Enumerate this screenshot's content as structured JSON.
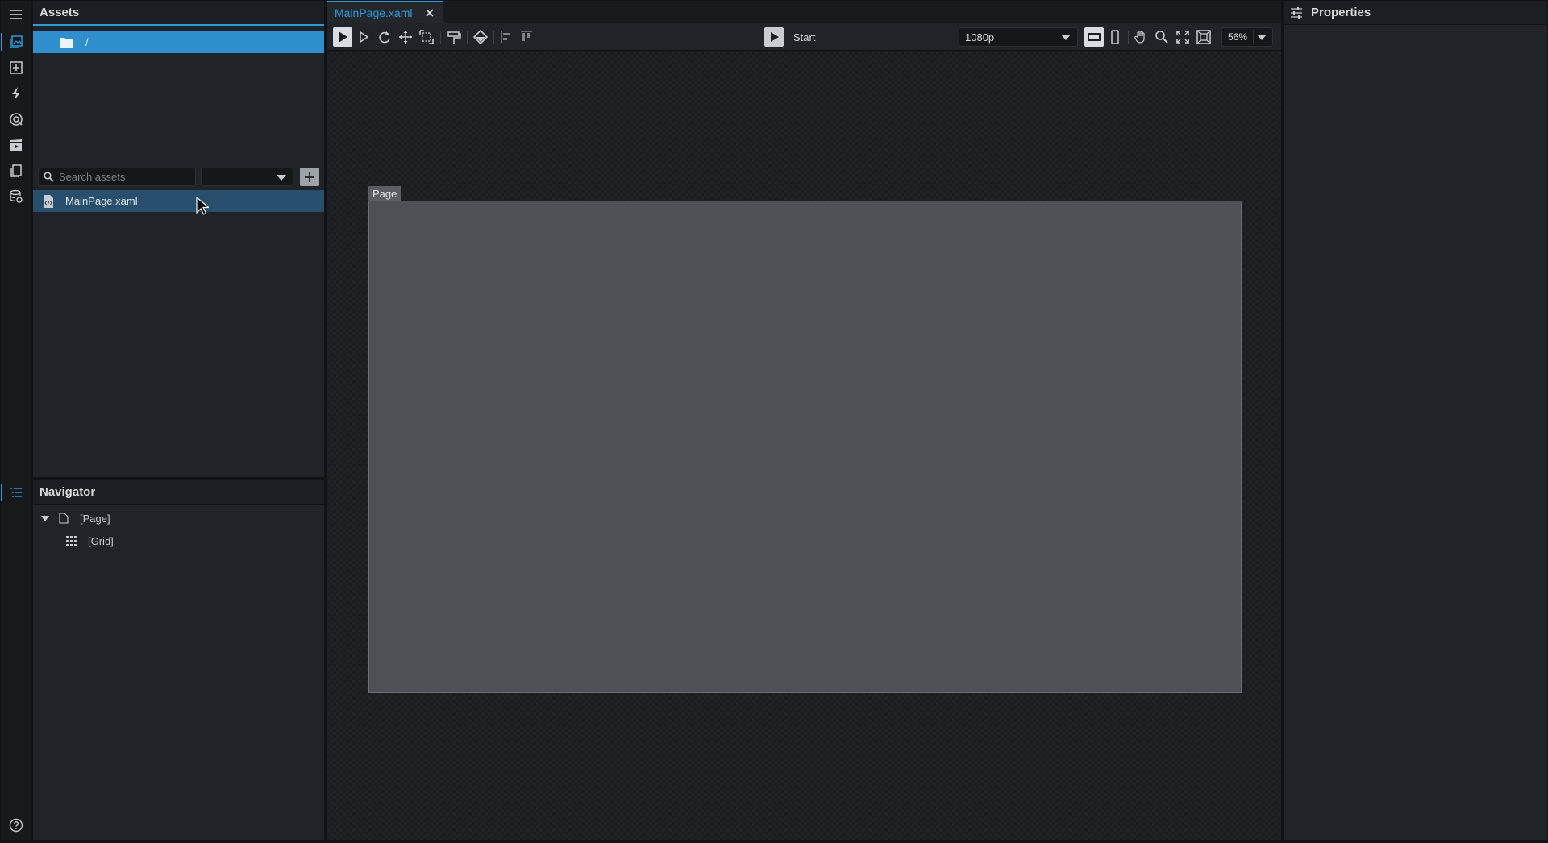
{
  "assets": {
    "title": "Assets",
    "folder_label": "/",
    "search_placeholder": "Search assets",
    "filter_value": "",
    "files": [
      {
        "name": "MainPage.xaml"
      }
    ]
  },
  "navigator": {
    "title": "Navigator",
    "tree": [
      {
        "label": "[Page]"
      },
      {
        "label": "[Grid]"
      }
    ]
  },
  "editor": {
    "tab_label": "MainPage.xaml",
    "start_label": "Start",
    "resolution": "1080p",
    "zoom": "56%",
    "page_tag": "Page"
  },
  "properties": {
    "title": "Properties"
  },
  "colors": {
    "accent": "#2d9bd8",
    "selection": "#2f8fcc",
    "file_selection": "#294f6e",
    "panel": "#202429",
    "page_surface": "#4d5155"
  },
  "icons": {
    "activity_bar": [
      "menu-icon",
      "assets-icon",
      "add-control-icon",
      "lightning-icon",
      "palette-icon",
      "media-icon",
      "pages-icon",
      "database-icon",
      "navigator-icon",
      "help-icon"
    ]
  }
}
